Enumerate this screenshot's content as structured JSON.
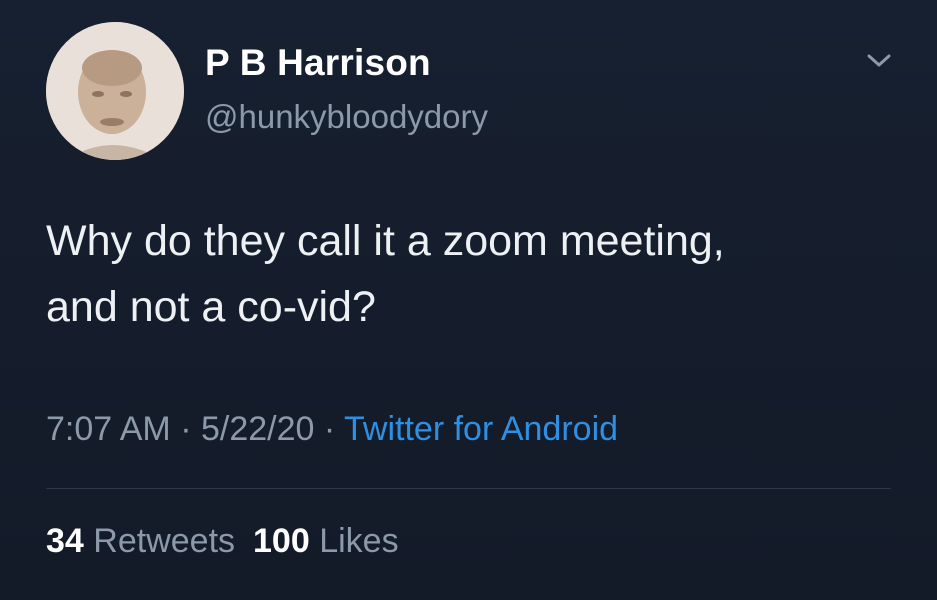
{
  "user": {
    "display_name": "P B Harrison",
    "handle": "@hunkybloodydory",
    "avatar_icon": "profile-photo"
  },
  "tweet": {
    "text_line1": "Why do they call it a zoom meeting,",
    "text_line2": "and not a co-vid?",
    "time": "7:07 AM",
    "sep1": " · ",
    "date": "5/22/20",
    "sep2": " · ",
    "source": "Twitter for Android"
  },
  "stats": {
    "retweets_count": "34",
    "retweets_label": "Retweets",
    "likes_count": "100",
    "likes_label": "Likes"
  },
  "menu": {
    "icon": "chevron-down-icon"
  },
  "colors": {
    "background": "#151c2b",
    "text": "#eef1f4",
    "secondary": "#8b99a8",
    "link": "#2f8fe2"
  }
}
